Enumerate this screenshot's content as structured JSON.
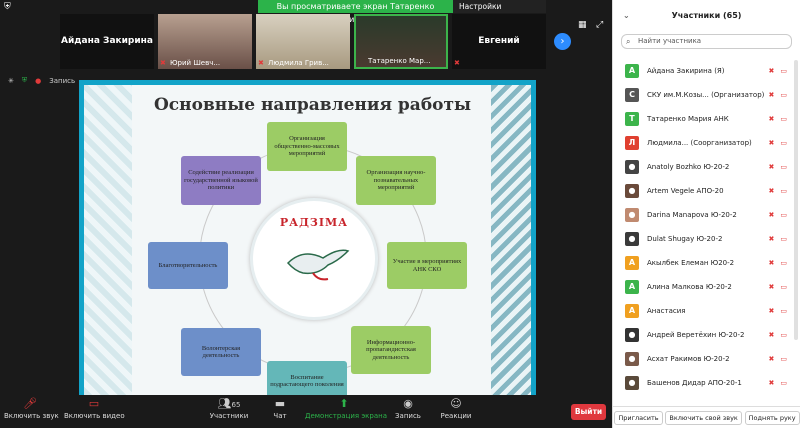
{
  "banner": {
    "view_text": "Вы просматриваете экран Татаренко Мария АНК",
    "settings": "Настройки просмотра ⌄"
  },
  "thumbs": [
    {
      "name": "Айдана Закирина",
      "type": "name_only"
    },
    {
      "name": "Юрий Шевч...",
      "type": "video"
    },
    {
      "name": "Людмила Грив...",
      "type": "video"
    },
    {
      "name": "Татаренко Мар...",
      "type": "video"
    },
    {
      "name": "Евгений",
      "type": "name_only"
    }
  ],
  "status": {
    "record": "Запись"
  },
  "slide": {
    "title": "Основные направления работы",
    "logo_text": "РАДЗІМА",
    "boxes": [
      "Организация общественно-массовых мероприятий",
      "Организация научно-познавательных мероприятий",
      "Участие в мероприятиях АНК СКО",
      "Информационно-пропагандистская деятельность",
      "Воспитание подрастающего поколения",
      "Волонтерская деятельность",
      "Благотворительность",
      "Содействие реализации государственной языковой политики"
    ]
  },
  "toolbar": {
    "mute": "Включить звук",
    "video": "Включить видео",
    "participants": "Участники",
    "participants_count": "65",
    "chat": "Чат",
    "share": "Демонстрация экрана",
    "record": "Запись",
    "reactions": "Реакции",
    "leave": "Выйти"
  },
  "panel": {
    "title": "Участники (65)",
    "search_placeholder": "Найти участника",
    "participants": [
      {
        "name": "Айдана Закирина (Я)",
        "avatar": "А",
        "color": "#3cb44b"
      },
      {
        "name": "СКУ им.М.Козы... (Организатор)",
        "avatar": "С",
        "color": "#555555"
      },
      {
        "name": "Татаренко Мария АНК",
        "avatar": "Т",
        "color": "#3cb44b"
      },
      {
        "name": "Людмила... (Соорганизатор)",
        "avatar": "Л",
        "color": "#e04030"
      },
      {
        "name": "Anatoly Bozhko Ю-20-2",
        "avatar": "●",
        "color": "#444444"
      },
      {
        "name": "Artem Vegele АПО-20",
        "avatar": "●",
        "color": "#6a4a3a"
      },
      {
        "name": "Darina Manapova Ю-20-2",
        "avatar": "●",
        "color": "#c08a70"
      },
      {
        "name": "Dulat Shugay Ю-20-2",
        "avatar": "●",
        "color": "#3a3a3a"
      },
      {
        "name": "Акылбек Елеман Ю20-2",
        "avatar": "А",
        "color": "#f0a020"
      },
      {
        "name": "Алина Малкова Ю-20-2",
        "avatar": "А",
        "color": "#3cb44b"
      },
      {
        "name": "Анастасия",
        "avatar": "А",
        "color": "#f0a020"
      },
      {
        "name": "Андрей Веретёхин Ю-20-2",
        "avatar": "●",
        "color": "#333333"
      },
      {
        "name": "Асхат Ракимов Ю-20-2",
        "avatar": "●",
        "color": "#7a5a4a"
      },
      {
        "name": "Башенов Дидар АПО-20-1",
        "avatar": "●",
        "color": "#5a4a3a"
      }
    ],
    "footer": {
      "invite": "Пригласить",
      "unmute_me": "Включить свой звук",
      "raise_hand": "Поднять руку"
    }
  }
}
